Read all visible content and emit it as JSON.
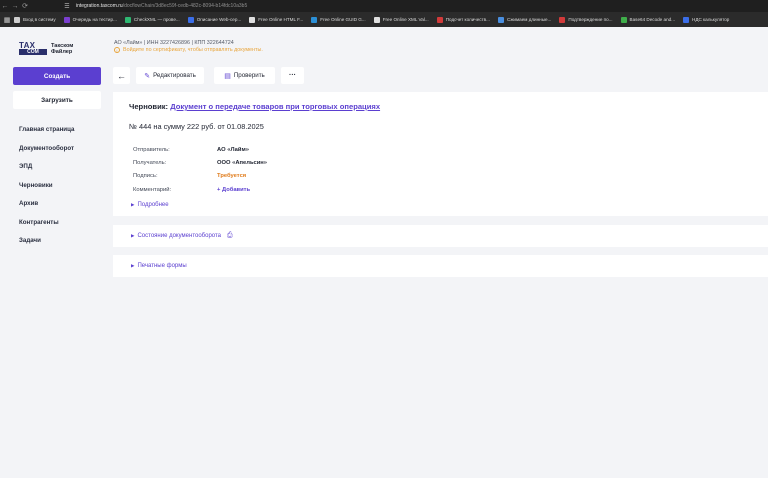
{
  "browser": {
    "url_host": "integration.taxcom.ru",
    "url_path": "/docflowChain/3d8ec59f-cedb-482c-8094-b14fdc10a3b5",
    "bookmarks": [
      {
        "label": "Вход в систему",
        "color": "#cfcfcf"
      },
      {
        "label": "Очередь на тестир...",
        "color": "#7b3fd0"
      },
      {
        "label": "CheckXML — прове...",
        "color": "#2eb872"
      },
      {
        "label": "Описание Web-сер...",
        "color": "#3b6ee8"
      },
      {
        "label": "Free Online HTML F...",
        "color": "#e0e0e0"
      },
      {
        "label": "Free Online GUID G...",
        "color": "#2b8fd6"
      },
      {
        "label": "Free Online XML Val...",
        "color": "#e0e0e0"
      },
      {
        "label": "Подсчет количеств...",
        "color": "#d23a3a"
      },
      {
        "label": "Сжимаем длинные...",
        "color": "#4a8fe0"
      },
      {
        "label": "Подтверждение по...",
        "color": "#d23a3a"
      },
      {
        "label": "Base64 Decode and...",
        "color": "#3fae4a"
      },
      {
        "label": "НДС калькулятор",
        "color": "#3b6ee8"
      }
    ]
  },
  "brand": {
    "mark_top": "TAX",
    "mark_bottom": "COM",
    "name": "Такском Файлер"
  },
  "org": {
    "line": "АО «Лайм»  |  ИНН 3227426896  |  КПП 322644724",
    "warning": "Войдите по сертификату, чтобы отправлять документы."
  },
  "sidebar": {
    "create_label": "Создать",
    "upload_label": "Загрузить",
    "items": [
      {
        "label": "Главная страница"
      },
      {
        "label": "Документооборот"
      },
      {
        "label": "ЭПД"
      },
      {
        "label": "Черновики"
      },
      {
        "label": "Архив"
      },
      {
        "label": "Контрагенты"
      },
      {
        "label": "Задачи"
      }
    ]
  },
  "toolbar": {
    "back_icon": "←",
    "edit_label": "Редактировать",
    "check_label": "Проверить",
    "more_label": "···"
  },
  "document": {
    "draft_prefix": "Черновик:",
    "title": "Документ о передаче товаров при торговых операциях",
    "subtitle": "№ 444 на сумму 222 руб. от 01.08.2025",
    "fields": [
      {
        "label": "Отправитель:",
        "value": "АО «Лайм»",
        "style": "normal"
      },
      {
        "label": "Получатель:",
        "value": "ООО «Апельсин»",
        "style": "normal"
      },
      {
        "label": "Подпись:",
        "value": "Требуется",
        "style": "orange"
      },
      {
        "label": "Комментарий:",
        "value": "+ Добавить",
        "style": "violet"
      }
    ],
    "more_label": "Подробнее"
  },
  "sections": {
    "state_label": "Состояние документооборота",
    "print_label": "Печатные формы"
  }
}
